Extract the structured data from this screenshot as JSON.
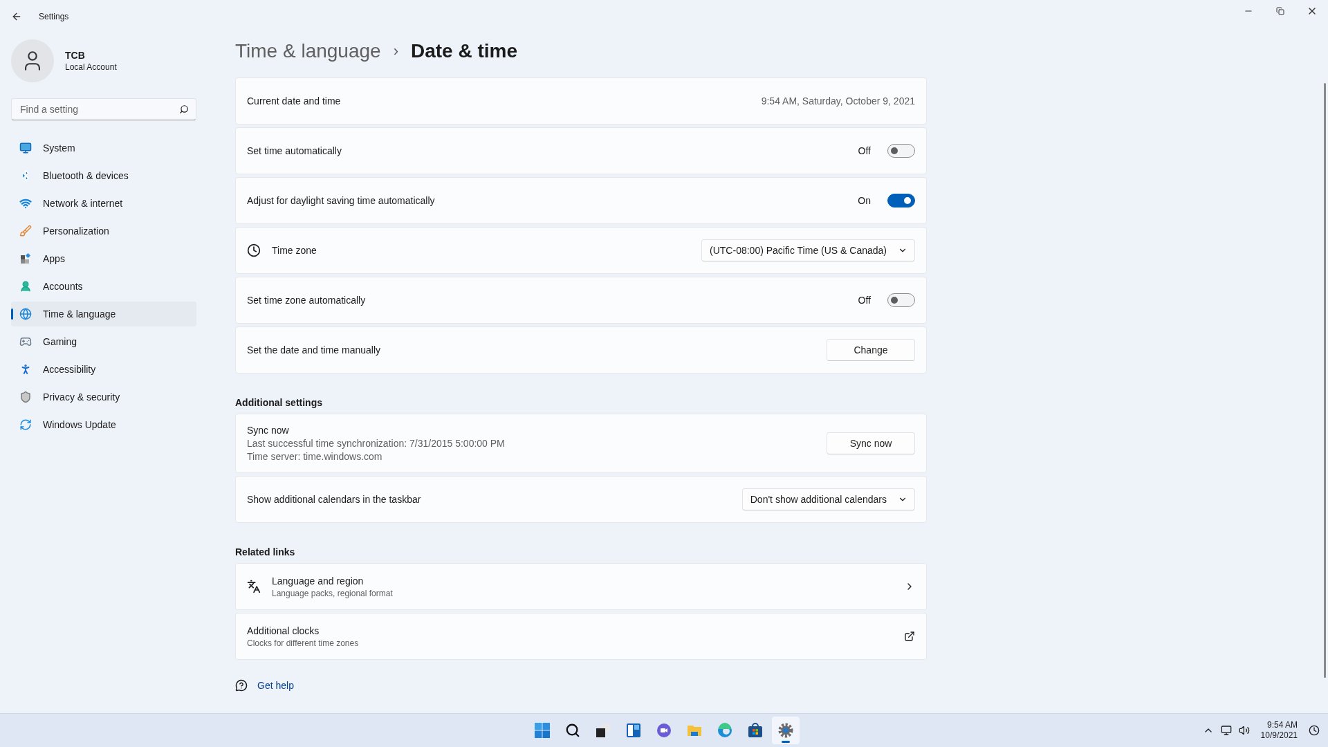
{
  "window": {
    "title": "Settings"
  },
  "user": {
    "name": "TCB",
    "account": "Local Account"
  },
  "search": {
    "placeholder": "Find a setting"
  },
  "nav": [
    {
      "label": "System",
      "selected": false
    },
    {
      "label": "Bluetooth & devices",
      "selected": false
    },
    {
      "label": "Network & internet",
      "selected": false
    },
    {
      "label": "Personalization",
      "selected": false
    },
    {
      "label": "Apps",
      "selected": false
    },
    {
      "label": "Accounts",
      "selected": false
    },
    {
      "label": "Time & language",
      "selected": true
    },
    {
      "label": "Gaming",
      "selected": false
    },
    {
      "label": "Accessibility",
      "selected": false
    },
    {
      "label": "Privacy & security",
      "selected": false
    },
    {
      "label": "Windows Update",
      "selected": false
    }
  ],
  "breadcrumb": {
    "parent": "Time & language",
    "separator": "›",
    "current": "Date & time"
  },
  "settings": [
    {
      "kind": "value",
      "label": "Current date and time",
      "value": "9:54 AM, Saturday, October 9, 2021"
    },
    {
      "kind": "toggle",
      "label": "Set time automatically",
      "state_label": "Off",
      "on": false
    },
    {
      "kind": "toggle",
      "label": "Adjust for daylight saving time automatically",
      "state_label": "On",
      "on": true
    },
    {
      "kind": "dropdown",
      "label": "Time zone",
      "value": "(UTC-08:00) Pacific Time (US & Canada)"
    },
    {
      "kind": "toggle",
      "label": "Set time zone automatically",
      "state_label": "Off",
      "on": false
    },
    {
      "kind": "button",
      "label": "Set the date and time manually",
      "button": "Change"
    }
  ],
  "sections": [
    {
      "heading": "Additional settings",
      "items": [
        {
          "kind": "sync",
          "label": "Sync now",
          "lines": [
            "Last successful time synchronization: 7/31/2015 5:00:00 PM",
            "Time server: time.windows.com"
          ],
          "button": "Sync now"
        },
        {
          "kind": "dropdown",
          "label": "Show additional calendars in the taskbar",
          "value": "Don't show additional calendars"
        }
      ]
    },
    {
      "heading": "Related links",
      "items": [
        {
          "kind": "link",
          "label": "Language and region",
          "subtitle": "Language packs, regional format"
        },
        {
          "kind": "external",
          "label": "Additional clocks",
          "subtitle": "Clocks for different time zones"
        }
      ]
    }
  ],
  "help": {
    "label": "Get help"
  },
  "taskbar": {
    "apps": [
      {
        "selected": false
      },
      {
        "selected": false
      },
      {
        "selected": false
      },
      {
        "selected": false
      },
      {
        "selected": false
      },
      {
        "selected": false
      },
      {
        "selected": false
      },
      {
        "selected": false
      },
      {
        "selected": true
      }
    ]
  },
  "tray": {
    "time": "9:54 AM",
    "date": "10/9/2021"
  }
}
